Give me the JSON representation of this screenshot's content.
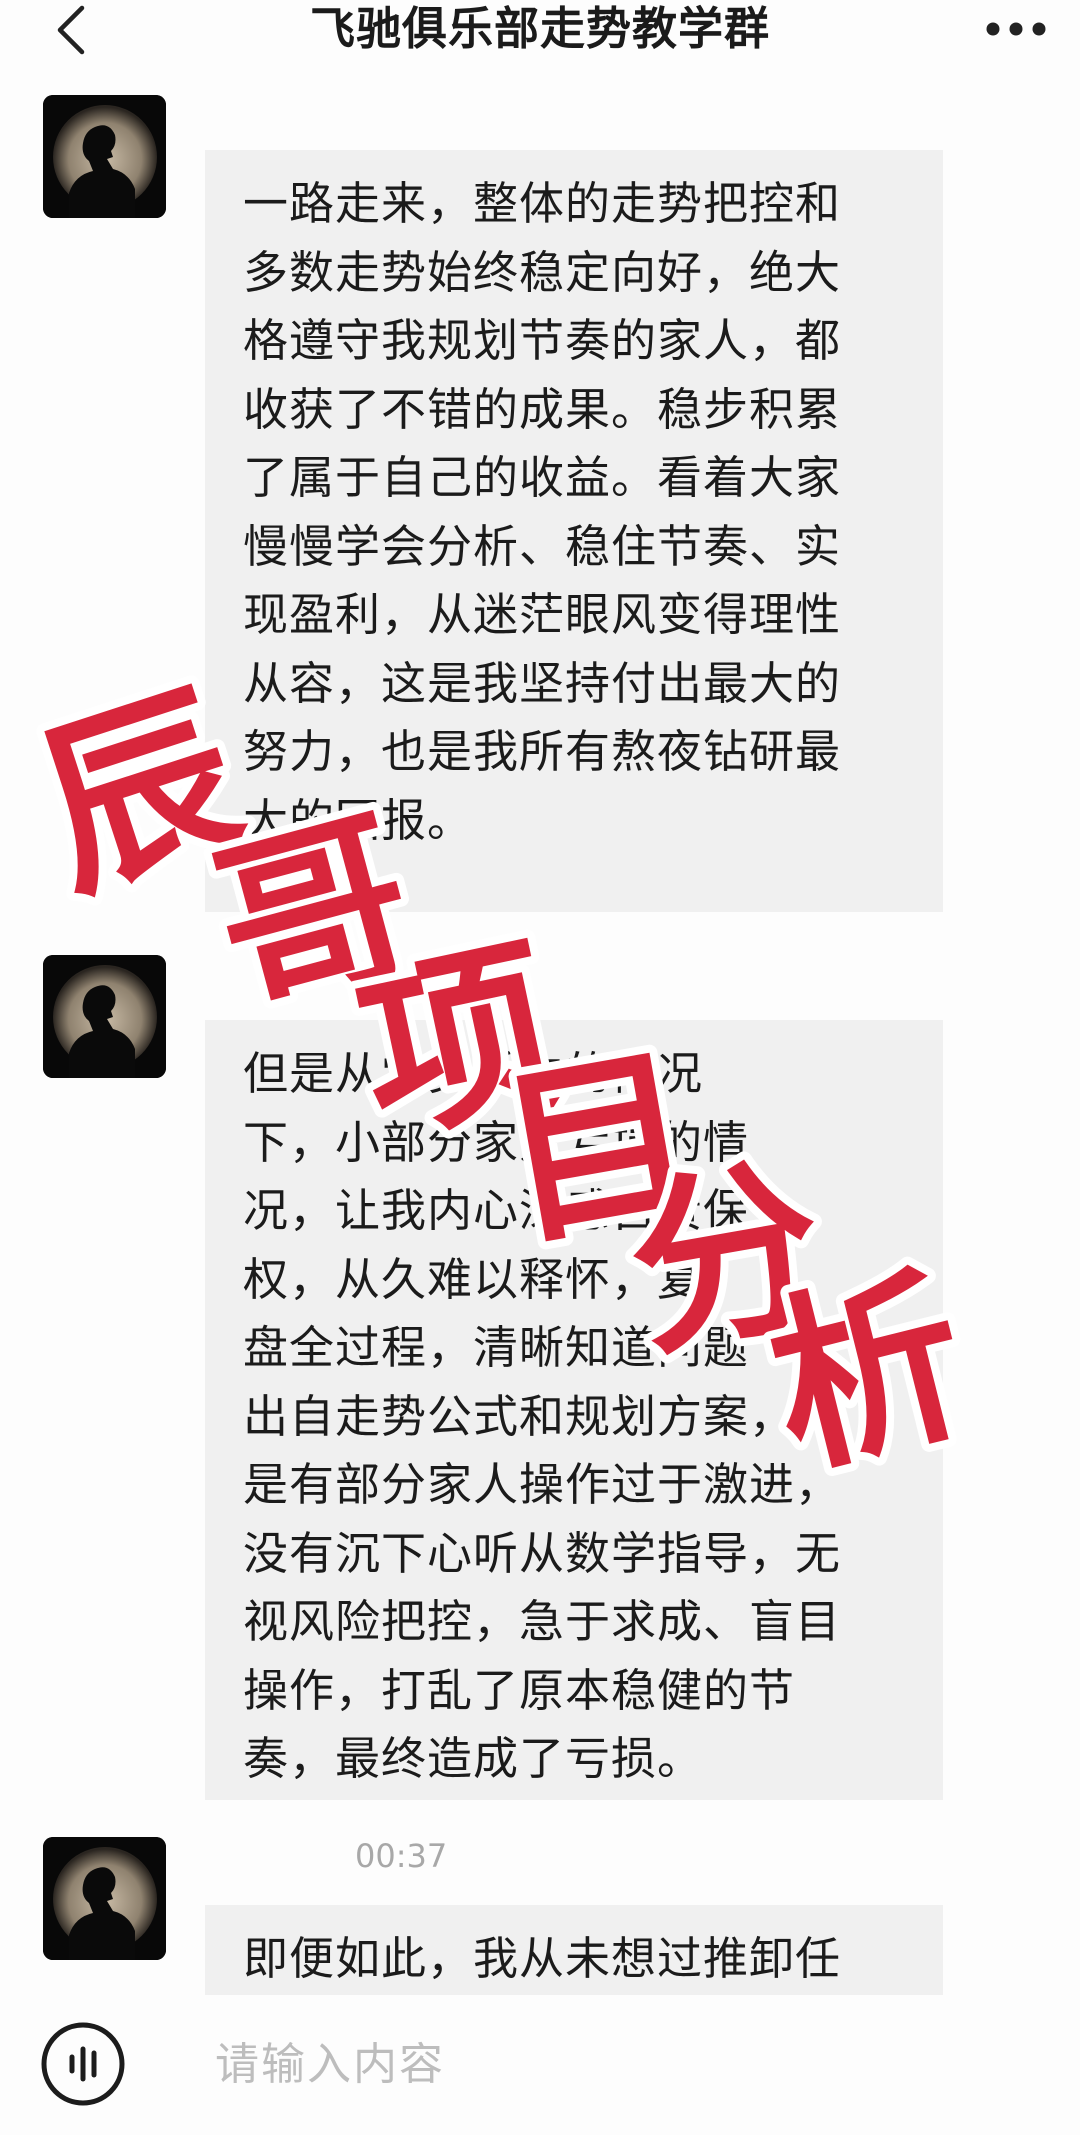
{
  "header": {
    "title": "飞驰俱乐部走势教学群",
    "back_icon": "chevron-left-icon",
    "more_icon": "more-dots-icon"
  },
  "messages": [
    {
      "avatar_icon": "silhouette-avatar",
      "text": "一路走来，整体的走势把控和\n多数走势始终稳定向好，绝大\n格遵守我规划节奏的家人，都\n收获了不错的成果。稳步积累\n了属于自己的收益。看着大家\n慢慢学会分析、稳住节奏、实\n现盈利，从迷茫眼风变得理性\n从容，这是我坚持付出最大的\n努力，也是我所有熬夜钻研最\n大的回报。"
    },
    {
      "avatar_icon": "silhouette-avatar",
      "text": "但是从学员手中的情况\n下，小部分家人亏损的情\n况，让我内心深感自责保\n权，从久难以释怀，复\n盘全过程，清晰知道问题\n出自走势公式和规划方案，\n是有部分家人操作过于激进，\n没有沉下心听从数学指导，无\n视风险把控，急于求成、盲目\n操作，打乱了原本稳健的节\n奏，最终造成了亏损。"
    },
    {
      "timestamp": "00:37",
      "avatar_icon": "silhouette-avatar",
      "text": "即便如此，我从未想过推卸任"
    }
  ],
  "watermark": {
    "text": "辰哥项目分析",
    "color": "#d8263c"
  },
  "input_bar": {
    "voice_icon": "voice-input-icon",
    "placeholder": "请输入内容"
  }
}
